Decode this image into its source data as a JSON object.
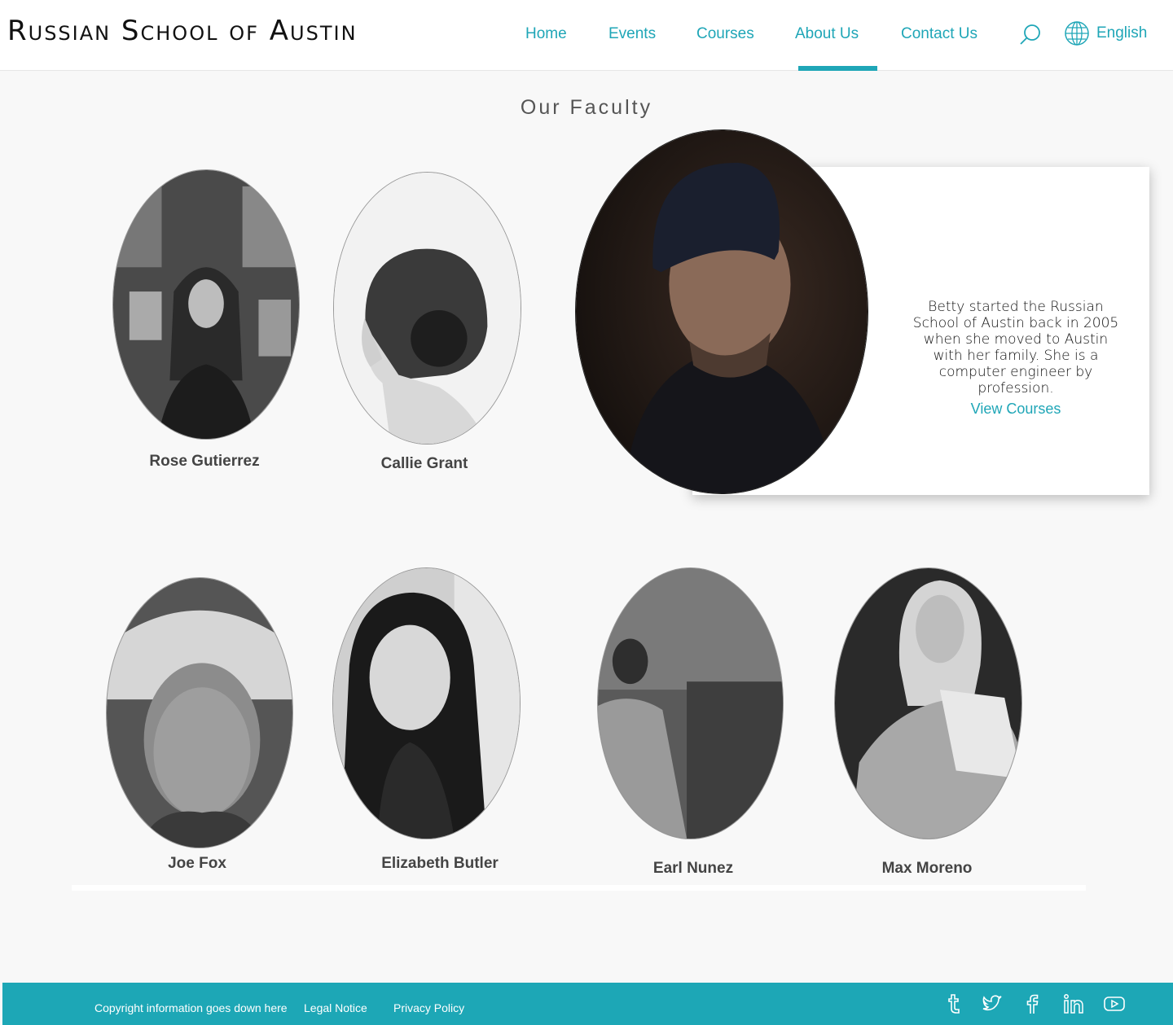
{
  "header": {
    "logo": "Russian School of Austin",
    "nav": [
      {
        "label": "Home"
      },
      {
        "label": "Events"
      },
      {
        "label": "Courses"
      },
      {
        "label": "About Us"
      },
      {
        "label": "Contact Us"
      }
    ],
    "active_nav": "About Us",
    "search_icon": "search-icon",
    "language": {
      "icon": "globe-icon",
      "label": "English"
    }
  },
  "main": {
    "title": "Our Faculty",
    "faculty": [
      {
        "name": "Rose Gutierrez"
      },
      {
        "name": "Callie Grant"
      },
      {
        "name": "Joe Fox"
      },
      {
        "name": "Elizabeth Butler"
      },
      {
        "name": "Earl Nunez"
      },
      {
        "name": "Max Moreno"
      }
    ],
    "featured": {
      "bio": "Betty started the Russian School of Austin back in 2005 when she moved to Austin with her family. She is a computer engineer by profession.",
      "link_label": "View Courses"
    }
  },
  "footer": {
    "copyright": "Copyright information goes down here",
    "legal": "Legal Notice",
    "privacy": "Privacy Policy",
    "social_icons": [
      "tumblr-icon",
      "twitter-icon",
      "facebook-icon",
      "linkedin-icon",
      "youtube-icon"
    ]
  },
  "colors": {
    "accent": "#1fa6b7",
    "footer_bg": "#1da7b6",
    "page_bg": "#f8f8f8"
  }
}
